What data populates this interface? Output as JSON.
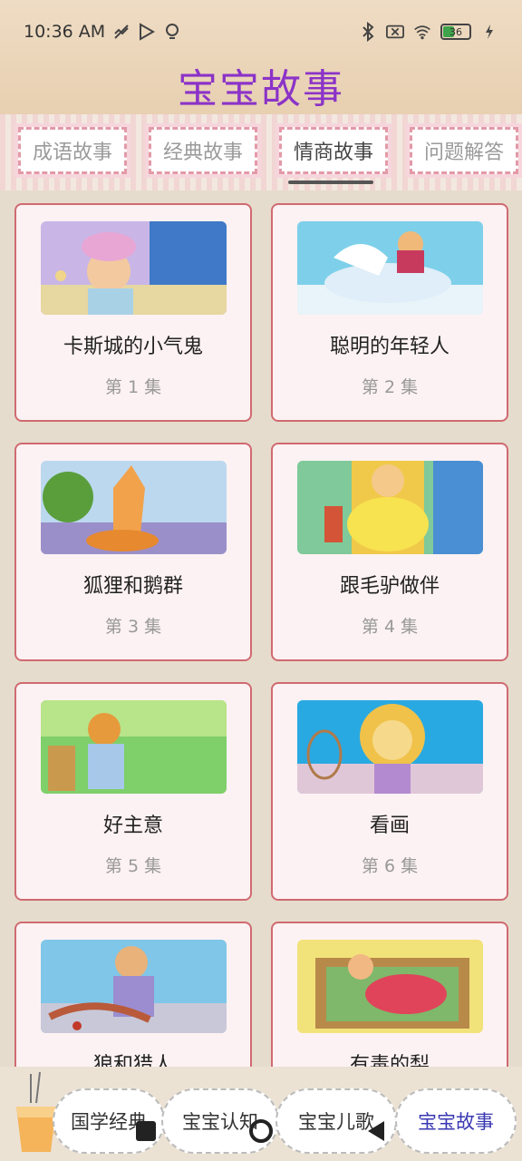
{
  "status_bar": {
    "time": "10:36 AM",
    "battery": "36"
  },
  "app": {
    "title": "宝宝故事"
  },
  "tabs": [
    {
      "label": "成语故事",
      "active": false
    },
    {
      "label": "经典故事",
      "active": false
    },
    {
      "label": "情商故事",
      "active": true
    },
    {
      "label": "问题解答",
      "active": false
    }
  ],
  "stories": [
    {
      "title": "卡斯城的小气鬼",
      "episode": "第 1 集"
    },
    {
      "title": "聪明的年轻人",
      "episode": "第 2 集"
    },
    {
      "title": "狐狸和鹅群",
      "episode": "第 3 集"
    },
    {
      "title": "跟毛驴做伴",
      "episode": "第 4 集"
    },
    {
      "title": "好主意",
      "episode": "第 5 集"
    },
    {
      "title": "看画",
      "episode": "第 6 集"
    },
    {
      "title": "狼和猎人",
      "episode": ""
    },
    {
      "title": "有毒的梨",
      "episode": ""
    }
  ],
  "bottom_nav": [
    {
      "label": "国学经典",
      "active": false
    },
    {
      "label": "宝宝认知",
      "active": false
    },
    {
      "label": "宝宝儿歌",
      "active": false
    },
    {
      "label": "宝宝故事",
      "active": true
    }
  ],
  "colors": {
    "title": "#8b33c8",
    "card_border": "#d06a70",
    "card_bg": "#fdf2f3",
    "active_nav": "#3a38b3"
  }
}
